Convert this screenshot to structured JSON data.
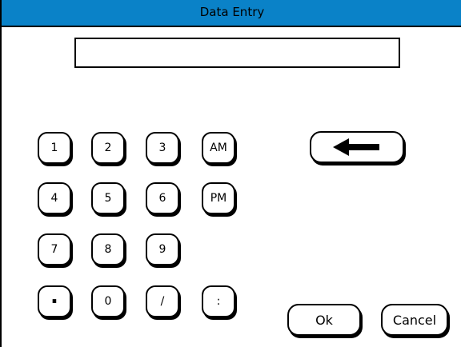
{
  "window": {
    "title": "Data Entry"
  },
  "entry": {
    "value": ""
  },
  "keypad": {
    "k1": "1",
    "k2": "2",
    "k3": "3",
    "am": "AM",
    "k4": "4",
    "k5": "5",
    "k6": "6",
    "pm": "PM",
    "k7": "7",
    "k8": "8",
    "k9": "9",
    "dot": ".",
    "k0": "0",
    "slash": "/",
    "colon": ":"
  },
  "buttons": {
    "ok": "Ok",
    "cancel": "Cancel"
  },
  "icons": {
    "backspace": "left-arrow-icon"
  }
}
